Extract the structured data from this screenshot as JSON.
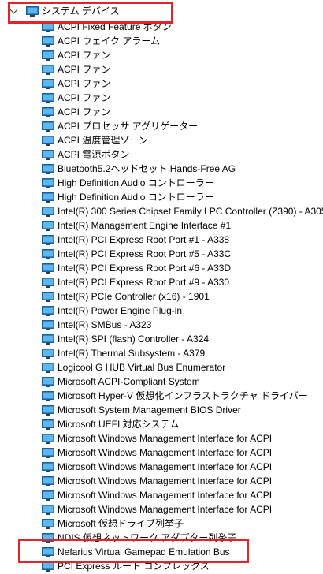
{
  "tree": {
    "category": {
      "label": "システム デバイス",
      "expanded": true,
      "icon": "system-devices-icon"
    },
    "devices": [
      {
        "label": "ACPI Fixed Feature ボタン",
        "icon": "device-icon"
      },
      {
        "label": "ACPI ウェイク アラーム",
        "icon": "device-icon"
      },
      {
        "label": "ACPI ファン",
        "icon": "device-icon"
      },
      {
        "label": "ACPI ファン",
        "icon": "device-icon"
      },
      {
        "label": "ACPI ファン",
        "icon": "device-icon"
      },
      {
        "label": "ACPI ファン",
        "icon": "device-icon"
      },
      {
        "label": "ACPI ファン",
        "icon": "device-icon"
      },
      {
        "label": "ACPI プロセッサ アグリゲーター",
        "icon": "device-icon"
      },
      {
        "label": "ACPI 温度管理ゾーン",
        "icon": "device-icon"
      },
      {
        "label": "ACPI 電源ボタン",
        "icon": "device-icon"
      },
      {
        "label": "Bluetooth5.2ヘッドセット Hands-Free AG",
        "icon": "device-icon"
      },
      {
        "label": "High Definition Audio コントローラー",
        "icon": "device-icon"
      },
      {
        "label": "High Definition Audio コントローラー",
        "icon": "device-icon"
      },
      {
        "label": "Intel(R) 300 Series Chipset Family LPC Controller (Z390) - A305",
        "icon": "device-icon"
      },
      {
        "label": "Intel(R) Management Engine Interface #1",
        "icon": "device-icon"
      },
      {
        "label": "Intel(R) PCI Express Root Port #1 - A338",
        "icon": "device-icon"
      },
      {
        "label": "Intel(R) PCI Express Root Port #5 - A33C",
        "icon": "device-icon"
      },
      {
        "label": "Intel(R) PCI Express Root Port #6 - A33D",
        "icon": "device-icon"
      },
      {
        "label": "Intel(R) PCI Express Root Port #9 - A330",
        "icon": "device-icon"
      },
      {
        "label": "Intel(R) PCIe Controller (x16) - 1901",
        "icon": "device-icon"
      },
      {
        "label": "Intel(R) Power Engine Plug-in",
        "icon": "device-icon"
      },
      {
        "label": "Intel(R) SMBus - A323",
        "icon": "device-icon"
      },
      {
        "label": "Intel(R) SPI (flash) Controller - A324",
        "icon": "device-icon"
      },
      {
        "label": "Intel(R) Thermal Subsystem - A379",
        "icon": "device-icon"
      },
      {
        "label": "Logicool G HUB Virtual Bus Enumerator",
        "icon": "device-icon"
      },
      {
        "label": "Microsoft ACPI-Compliant System",
        "icon": "device-icon"
      },
      {
        "label": "Microsoft Hyper-V 仮想化インフラストラクチャ ドライバー",
        "icon": "device-icon"
      },
      {
        "label": "Microsoft System Management BIOS Driver",
        "icon": "device-icon"
      },
      {
        "label": "Microsoft UEFI 対応システム",
        "icon": "device-icon"
      },
      {
        "label": "Microsoft Windows Management Interface for ACPI",
        "icon": "device-icon"
      },
      {
        "label": "Microsoft Windows Management Interface for ACPI",
        "icon": "device-icon"
      },
      {
        "label": "Microsoft Windows Management Interface for ACPI",
        "icon": "device-icon"
      },
      {
        "label": "Microsoft Windows Management Interface for ACPI",
        "icon": "device-icon"
      },
      {
        "label": "Microsoft Windows Management Interface for ACPI",
        "icon": "device-icon"
      },
      {
        "label": "Microsoft Windows Management Interface for ACPI",
        "icon": "device-icon"
      },
      {
        "label": "Microsoft 仮想ドライブ列挙子",
        "icon": "device-icon"
      },
      {
        "label": "NDIS 仮想ネットワーク アダプター列挙子",
        "icon": "device-icon"
      },
      {
        "label": "Nefarius Virtual Gamepad Emulation Bus",
        "icon": "device-icon"
      },
      {
        "label": "PCI Express ルート コンプレックス",
        "icon": "device-icon"
      }
    ]
  },
  "colors": {
    "highlight": "#e1242b",
    "icon_monitor": "#2b87d1",
    "icon_screen": "#5fb7f0",
    "icon_base": "#3a3a3a"
  }
}
